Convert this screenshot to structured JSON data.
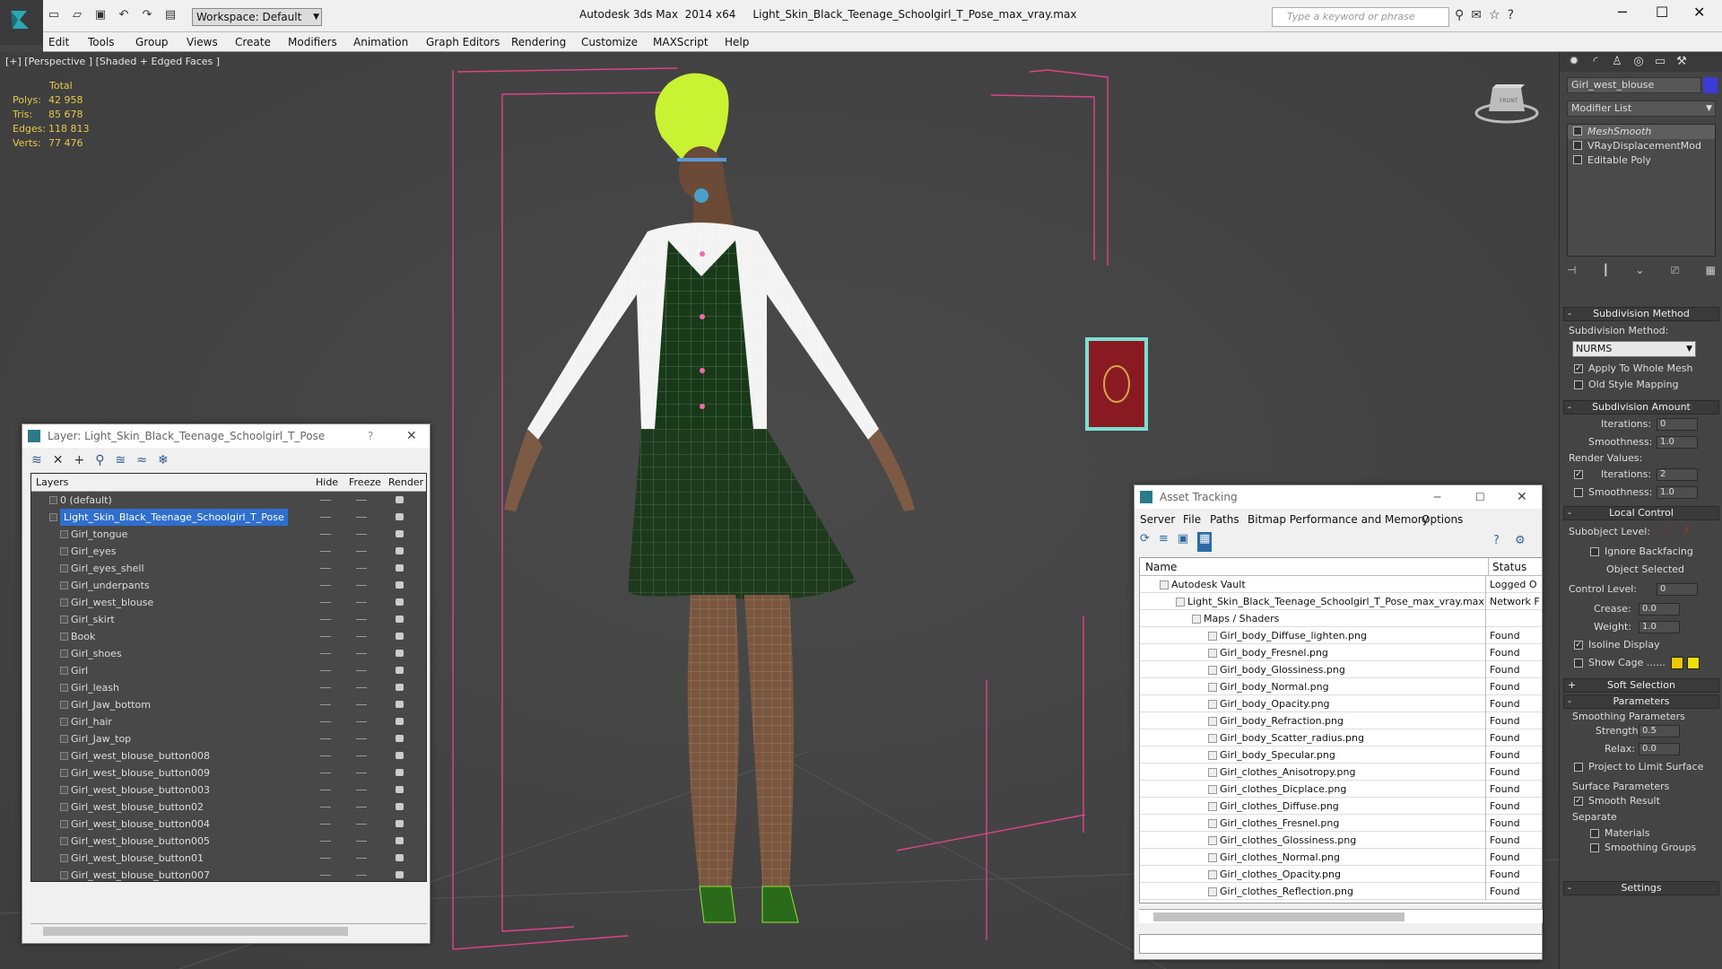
{
  "app": {
    "window_title": "Autodesk 3ds Max  2014 x64     Light_Skin_Black_Teenage_Schoolgirl_T_Pose_max_vray.max",
    "workspace": "Workspace: Default",
    "search_placeholder": "Type a keyword or phrase"
  },
  "menu": [
    "Edit",
    "Tools",
    "Group",
    "Views",
    "Create",
    "Modifiers",
    "Animation",
    "Graph Editors",
    "Rendering",
    "Customize",
    "MAXScript",
    "Help"
  ],
  "viewport": {
    "label": "[+] [Perspective ] [Shaded + Edged Faces ]",
    "viewcube_label": "FRONT",
    "stats": {
      "header": "Total",
      "rows": [
        {
          "k": "Polys:",
          "v": "42 958"
        },
        {
          "k": "Tris:",
          "v": "85 678"
        },
        {
          "k": "Edges:",
          "v": "118 813"
        },
        {
          "k": "Verts:",
          "v": "77 476"
        }
      ]
    }
  },
  "command_panel": {
    "object_name": "Girl_west_blouse",
    "object_color": "#3b3bd8",
    "modifier_list_label": "Modifier List",
    "stack": [
      "MeshSmooth",
      "VRayDisplacementMod",
      "Editable Poly"
    ],
    "subdivision_method": {
      "title": "Subdivision Method",
      "label": "Subdivision Method:",
      "value": "NURMS",
      "apply_whole_mesh": "Apply To Whole Mesh",
      "old_style": "Old Style Mapping"
    },
    "subdivision_amount": {
      "title": "Subdivision Amount",
      "iterations_label": "Iterations:",
      "iterations": "0",
      "smoothness_label": "Smoothness:",
      "smoothness": "1.0",
      "render_values": "Render Values:",
      "r_iterations_label": "Iterations:",
      "r_iterations": "2",
      "r_smoothness_label": "Smoothness:",
      "r_smoothness": "1.0"
    },
    "local_control": {
      "title": "Local Control",
      "subobject_level": "Subobject Level:",
      "ignore_backfacing": "Ignore Backfacing",
      "object_selected": "Object Selected",
      "control_level_label": "Control Level:",
      "control_level": "0",
      "crease_label": "Crease:",
      "crease": "0.0",
      "weight_label": "Weight:",
      "weight": "1.0",
      "isoline_display": "Isoline Display",
      "show_cage": "Show Cage ......",
      "cage_color_1": "#f0c800",
      "cage_color_2": "#f0e000"
    },
    "soft_selection": "Soft Selection",
    "parameters": {
      "title": "Parameters",
      "smoothing_parameters": "Smoothing Parameters",
      "strength_label": "Strength:",
      "strength": "0.5",
      "relax_label": "Relax:",
      "relax": "0.0",
      "project_limit": "Project to Limit Surface",
      "surface_parameters": "Surface Parameters",
      "smooth_result": "Smooth Result",
      "separate": "Separate",
      "materials": "Materials",
      "smoothing_groups": "Smoothing Groups"
    },
    "settings": "Settings"
  },
  "layer_manager": {
    "title": "Layer: Light_Skin_Black_Teenage_Schoolgirl_T_Pose",
    "help": "?",
    "columns": {
      "layers": "Layers",
      "hide": "Hide",
      "freeze": "Freeze",
      "render": "Render"
    },
    "rows": [
      {
        "name": "0 (default)",
        "level": 0
      },
      {
        "name": "Light_Skin_Black_Teenage_Schoolgirl_T_Pose",
        "level": 0,
        "selected": true
      },
      {
        "name": "Girl_tongue",
        "level": 1
      },
      {
        "name": "Girl_eyes",
        "level": 1
      },
      {
        "name": "Girl_eyes_shell",
        "level": 1
      },
      {
        "name": "Girl_underpants",
        "level": 1
      },
      {
        "name": "Girl_west_blouse",
        "level": 1
      },
      {
        "name": "Girl_skirt",
        "level": 1
      },
      {
        "name": "Book",
        "level": 1
      },
      {
        "name": "Girl_shoes",
        "level": 1
      },
      {
        "name": "Girl",
        "level": 1
      },
      {
        "name": "Girl_leash",
        "level": 1
      },
      {
        "name": "Girl_Jaw_bottom",
        "level": 1
      },
      {
        "name": "Girl_hair",
        "level": 1
      },
      {
        "name": "Girl_Jaw_top",
        "level": 1
      },
      {
        "name": "Girl_west_blouse_button008",
        "level": 1
      },
      {
        "name": "Girl_west_blouse_button009",
        "level": 1
      },
      {
        "name": "Girl_west_blouse_button003",
        "level": 1
      },
      {
        "name": "Girl_west_blouse_button02",
        "level": 1
      },
      {
        "name": "Girl_west_blouse_button004",
        "level": 1
      },
      {
        "name": "Girl_west_blouse_button005",
        "level": 1
      },
      {
        "name": "Girl_west_blouse_button01",
        "level": 1
      },
      {
        "name": "Girl_west_blouse_button007",
        "level": 1
      },
      {
        "name": "Light_Skin_Black_Teenage_Schoolgirl_T_Pose",
        "level": 1
      }
    ]
  },
  "asset_tracking": {
    "title": "Asset Tracking",
    "menu": [
      "Server",
      "File",
      "Paths",
      "Bitmap Performance and Memory",
      "Options"
    ],
    "columns": {
      "name": "Name",
      "status": "Status"
    },
    "rows": [
      {
        "name": "Autodesk Vault",
        "status": "Logged O",
        "level": 1
      },
      {
        "name": "Light_Skin_Black_Teenage_Schoolgirl_T_Pose_max_vray.max",
        "status": "Network F",
        "level": 2
      },
      {
        "name": "Maps / Shaders",
        "status": "",
        "level": 3
      },
      {
        "name": "Girl_body_Diffuse_lighten.png",
        "status": "Found",
        "level": 4
      },
      {
        "name": "Girl_body_Fresnel.png",
        "status": "Found",
        "level": 4
      },
      {
        "name": "Girl_body_Glossiness.png",
        "status": "Found",
        "level": 4
      },
      {
        "name": "Girl_body_Normal.png",
        "status": "Found",
        "level": 4
      },
      {
        "name": "Girl_body_Opacity.png",
        "status": "Found",
        "level": 4
      },
      {
        "name": "Girl_body_Refraction.png",
        "status": "Found",
        "level": 4
      },
      {
        "name": "Girl_body_Scatter_radius.png",
        "status": "Found",
        "level": 4
      },
      {
        "name": "Girl_body_Specular.png",
        "status": "Found",
        "level": 4
      },
      {
        "name": "Girl_clothes_Anisotropy.png",
        "status": "Found",
        "level": 4
      },
      {
        "name": "Girl_clothes_Dicplace.png",
        "status": "Found",
        "level": 4
      },
      {
        "name": "Girl_clothes_Diffuse.png",
        "status": "Found",
        "level": 4
      },
      {
        "name": "Girl_clothes_Fresnel.png",
        "status": "Found",
        "level": 4
      },
      {
        "name": "Girl_clothes_Glossiness.png",
        "status": "Found",
        "level": 4
      },
      {
        "name": "Girl_clothes_Normal.png",
        "status": "Found",
        "level": 4
      },
      {
        "name": "Girl_clothes_Opacity.png",
        "status": "Found",
        "level": 4
      },
      {
        "name": "Girl_clothes_Reflection.png",
        "status": "Found",
        "level": 4
      }
    ]
  }
}
